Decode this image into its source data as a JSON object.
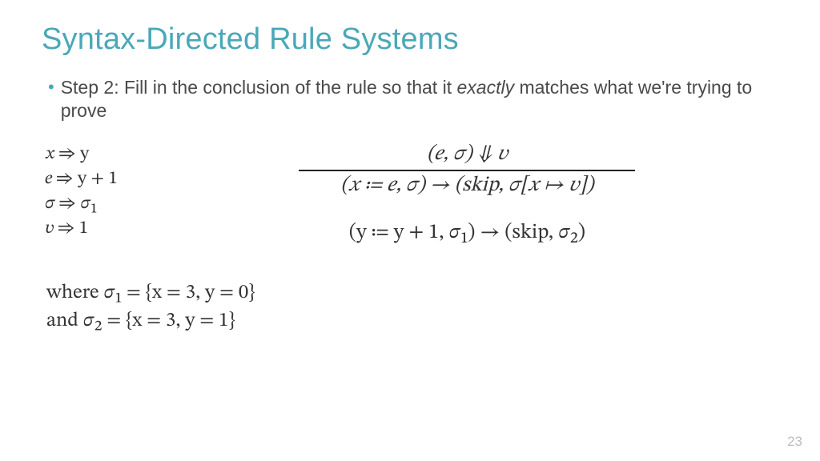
{
  "title": "Syntax-Directed Rule Systems",
  "bullet": {
    "lead": "Step 2: Fill in the conclusion of the rule so that it ",
    "emph": "exactly",
    "tail": " matches what we're trying to prove"
  },
  "subst": {
    "l1": "𝑥 ⇒ y",
    "l2": "𝑒 ⇒ y + 1",
    "l3": "𝜎 ⇒ 𝜎₁",
    "l4": "𝑣 ⇒ 1"
  },
  "rule": {
    "premise": "(𝑒, 𝜎) ⇓ 𝑣",
    "conclusion": "(𝑥 ≔ 𝑒, 𝜎) → (skip, 𝜎[𝑥 ↦ 𝑣])"
  },
  "instance": "(y ≔ y + 1, 𝜎₁) → (skip, 𝜎₂)",
  "defs": {
    "d1": "where 𝜎₁ = {x = 3, y = 0}",
    "d2": "and 𝜎₂ = {x = 3, y = 1}"
  },
  "page": "23"
}
